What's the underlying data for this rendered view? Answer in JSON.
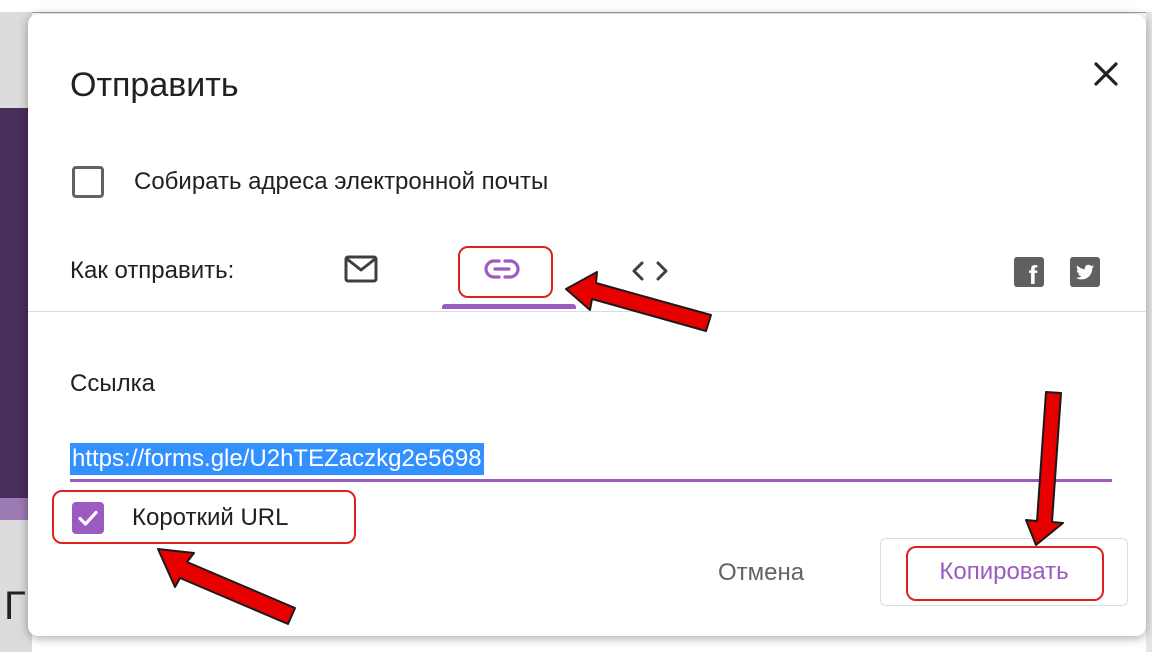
{
  "dialog": {
    "title": "Отправить",
    "collect_emails_label": "Собирать адреса электронной почты",
    "send_via_label": "Как отправить:",
    "tabs": [
      {
        "icon": "mail-icon"
      },
      {
        "icon": "link-icon",
        "selected": true
      },
      {
        "icon": "embed-code-icon"
      }
    ],
    "social": [
      {
        "icon": "facebook-icon",
        "glyph": "f"
      },
      {
        "icon": "twitter-icon"
      }
    ],
    "link_section": {
      "label": "Ссылка",
      "url": "https://forms.gle/U2hTEZaczkg2e5698",
      "short_url_label": "Короткий URL",
      "short_url_checked": true
    },
    "cancel_label": "Отмена",
    "copy_label": "Копировать"
  },
  "colors": {
    "accent": "#9c5bc0",
    "highlight": "#3390ff",
    "annotation": "#e02020"
  }
}
